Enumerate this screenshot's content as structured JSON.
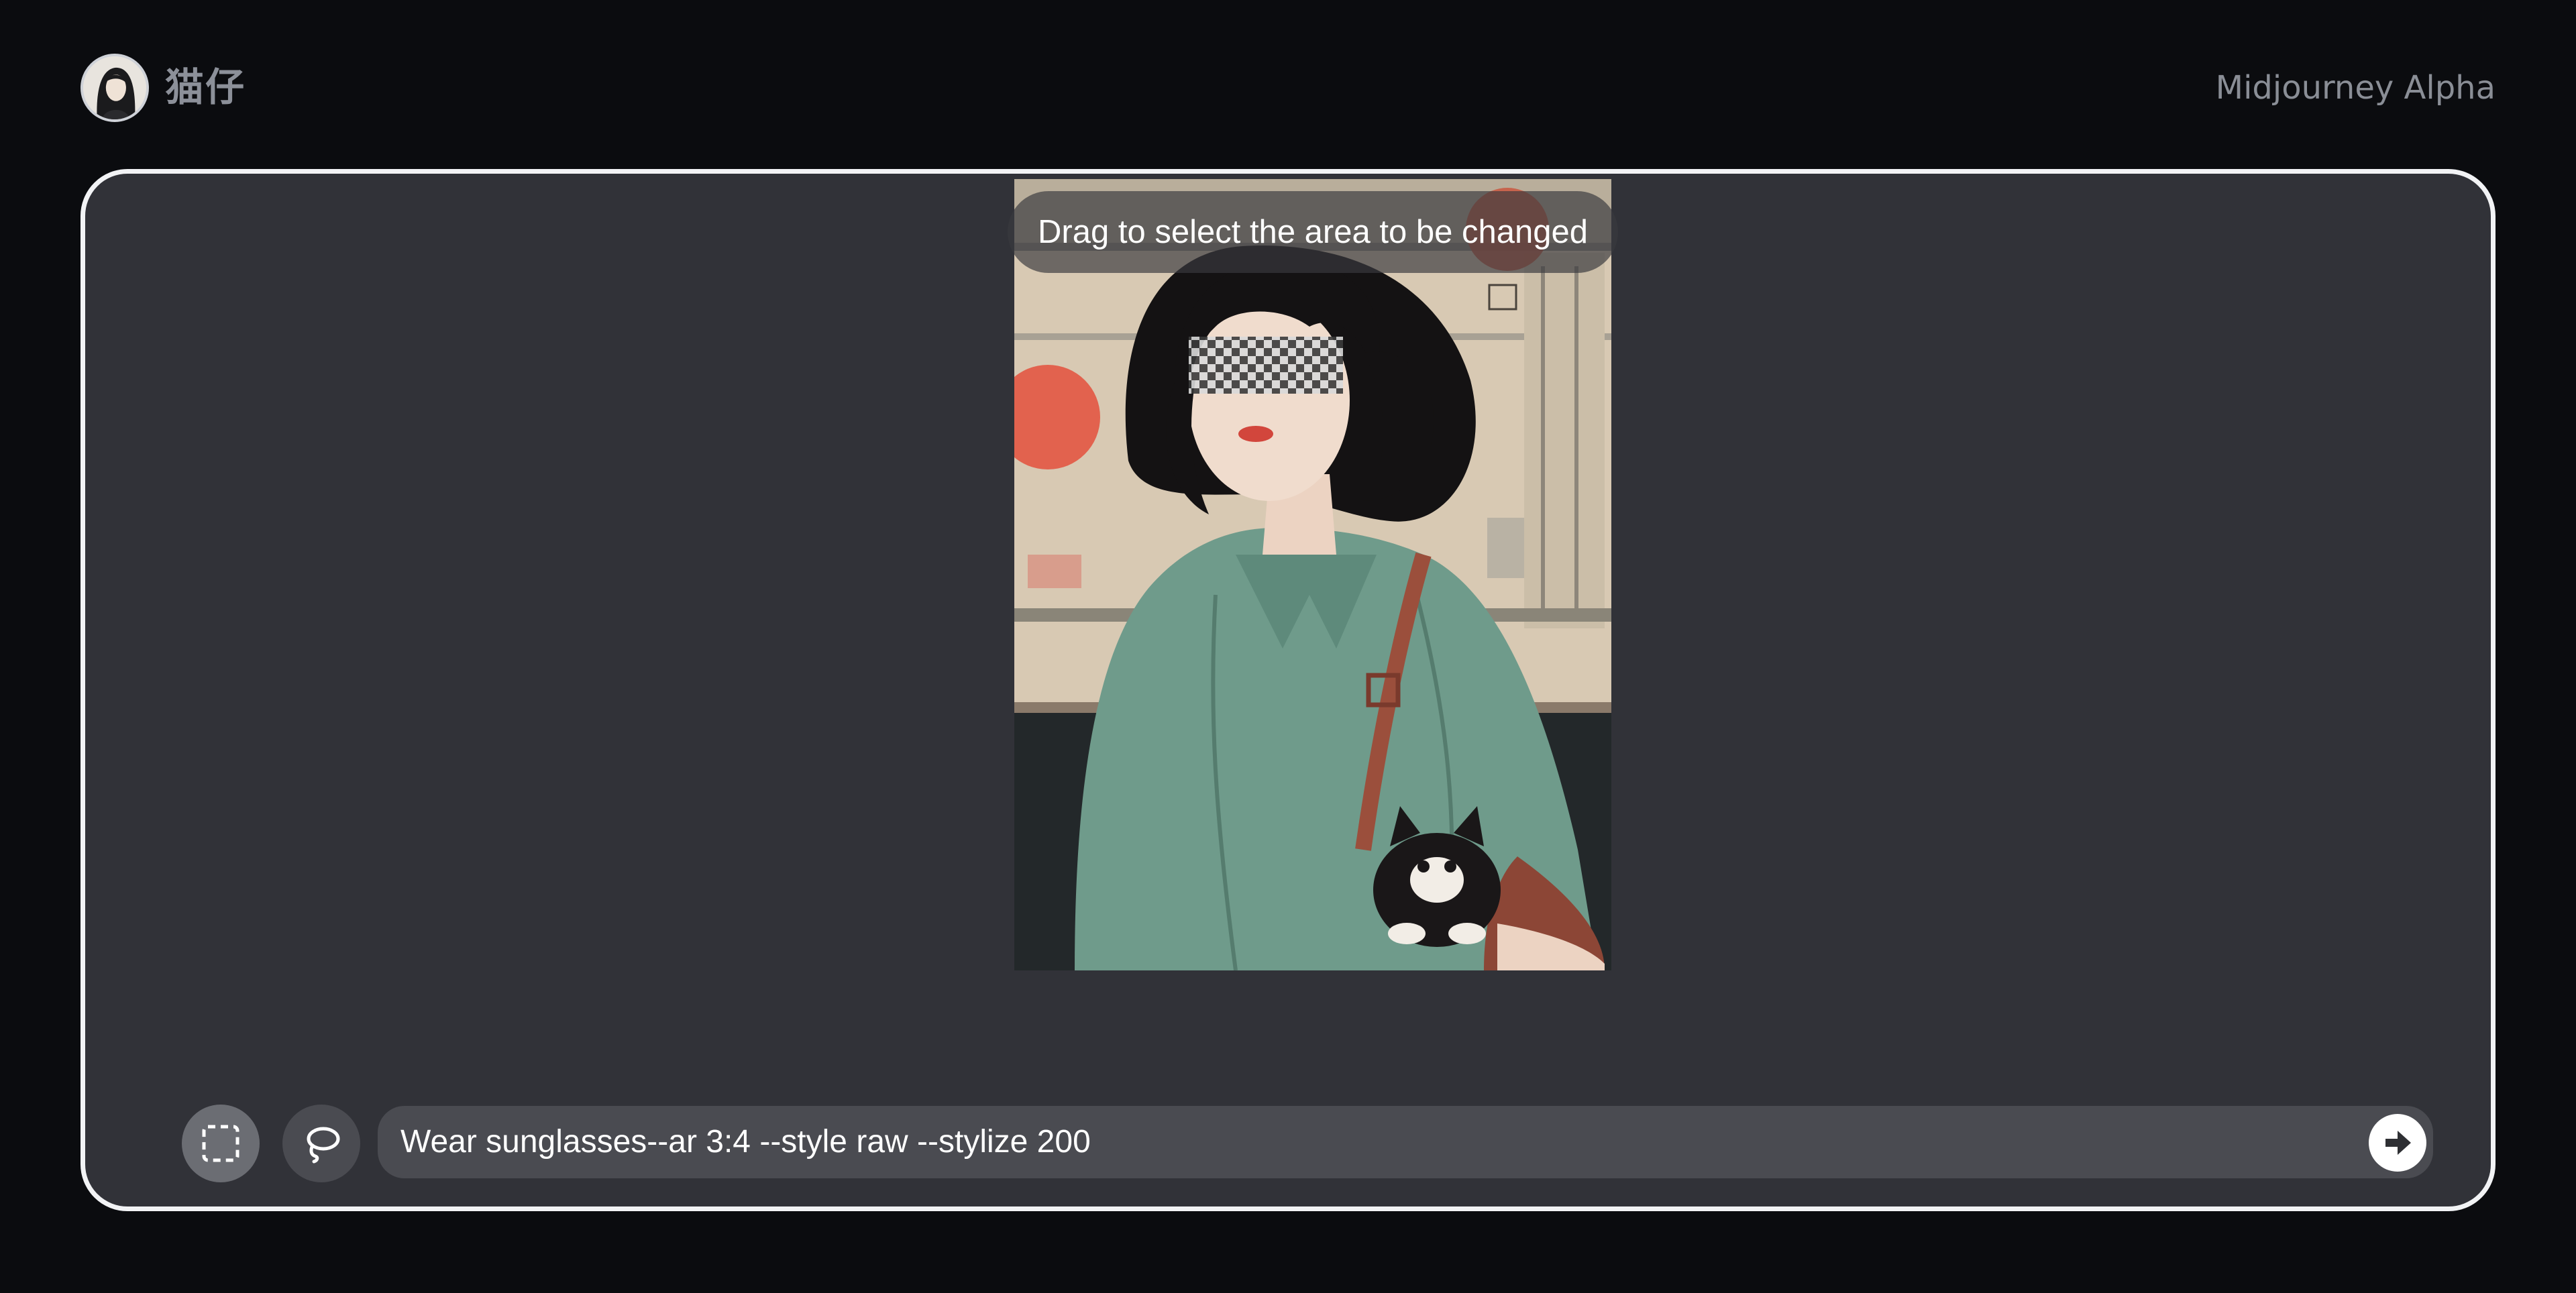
{
  "header": {
    "username": "猫仔",
    "brand": "Midjourney Alpha"
  },
  "editor": {
    "hint": "Drag to select the area to be changed",
    "prompt_value": "Wear sunglasses--ar 3:4 --style raw --stylize 200"
  },
  "icons": {
    "avatar": "user-avatar",
    "select_tool": "rectangle-select-icon",
    "lasso_tool": "lasso-icon",
    "send": "arrow-right-icon"
  },
  "colors": {
    "background": "#0b0c0f",
    "panel": "#313238",
    "panel_border": "#f2f3f5",
    "input": "#4a4b51",
    "text_muted": "#8a8e96"
  }
}
